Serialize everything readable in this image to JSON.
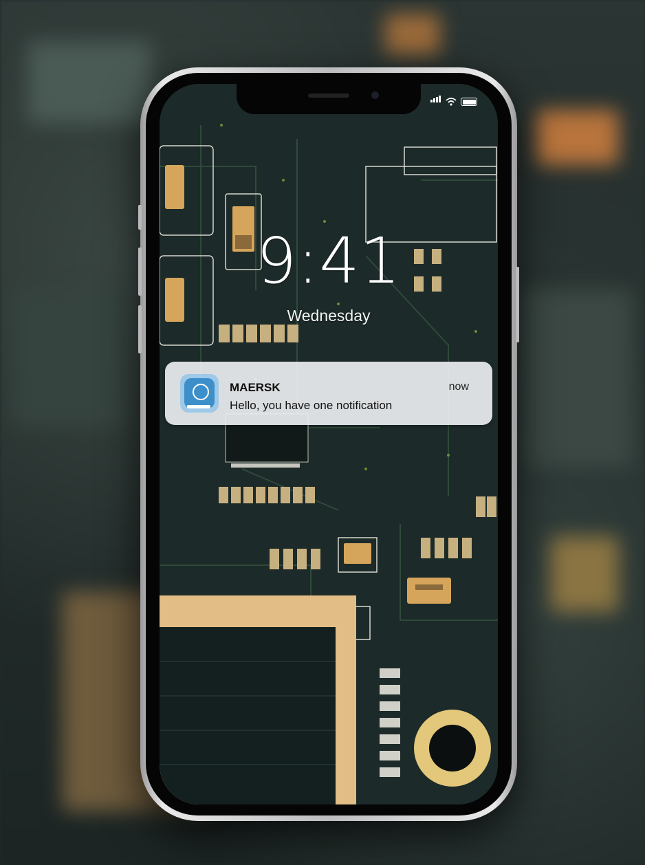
{
  "lock_screen": {
    "time": "9:41",
    "day": "Wednesday"
  },
  "notification": {
    "app_name": "MAERSK",
    "timestamp": "now",
    "message": "Hello, you have one notification",
    "icon": "maersk-app-icon"
  },
  "status_bar": {
    "icons": [
      "signal-icon",
      "wifi-icon",
      "battery-icon"
    ]
  }
}
